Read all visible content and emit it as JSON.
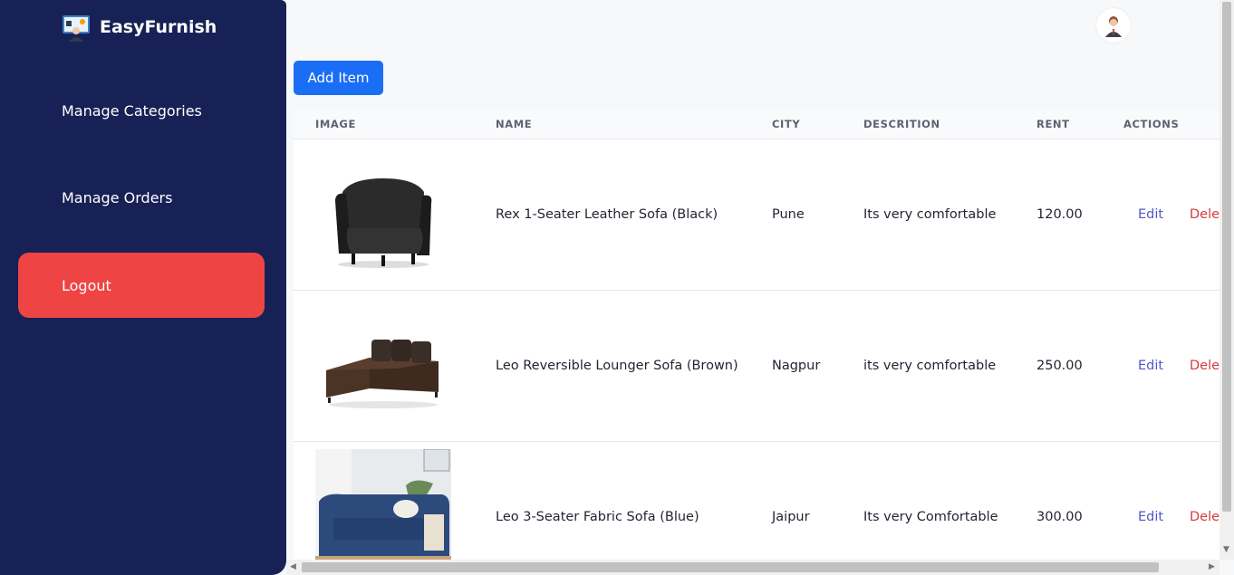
{
  "app": {
    "brand": "EasyFurnish"
  },
  "sidebar": {
    "items": [
      {
        "label": "Manage Categories"
      },
      {
        "label": "Manage Orders"
      },
      {
        "label": "Logout"
      }
    ]
  },
  "toolbar": {
    "add_label": "Add Item"
  },
  "table": {
    "headers": [
      "IMAGE",
      "NAME",
      "CITY",
      "DESCRITION",
      "RENT",
      "ACTIONS"
    ],
    "rows": [
      {
        "name": "Rex 1-Seater Leather Sofa (Black)",
        "city": "Pune",
        "description": "Its very comfortable",
        "rent": "120.00",
        "edit": "Edit",
        "delete": "Delete"
      },
      {
        "name": "Leo Reversible Lounger Sofa (Brown)",
        "city": "Nagpur",
        "description": "its very comfortable",
        "rent": "250.00",
        "edit": "Edit",
        "delete": "Delete"
      },
      {
        "name": "Leo 3-Seater Fabric Sofa (Blue)",
        "city": "Jaipur",
        "description": "Its very Comfortable",
        "rent": "300.00",
        "edit": "Edit",
        "delete": "Delete"
      }
    ]
  },
  "colors": {
    "sidebar": "#172155",
    "logout": "#ef4444",
    "primary": "#1a6ef5",
    "edit": "#5457c9",
    "delete": "#d43b3b"
  },
  "icons": {
    "brand": "admin-logo-icon",
    "avatar": "user-avatar-icon"
  }
}
